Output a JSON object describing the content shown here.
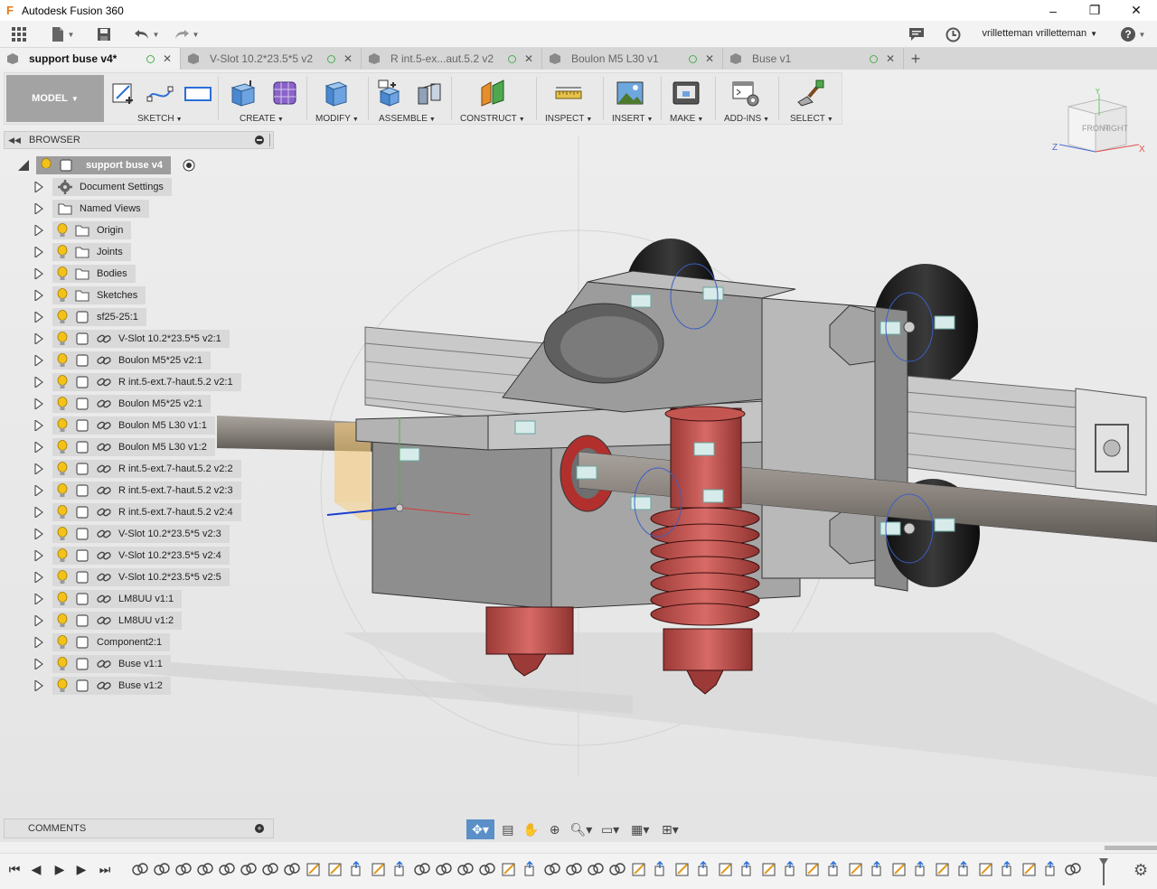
{
  "window": {
    "title": "Autodesk Fusion 360",
    "app_icon": "F",
    "minimize": "–",
    "restore": "❐",
    "close": "✕"
  },
  "quickbar": {
    "user": "vrilletteman vrilletteman"
  },
  "tabs": [
    {
      "label": "support buse v4*",
      "active": true
    },
    {
      "label": "V-Slot 10.2*23.5*5 v2",
      "active": false
    },
    {
      "label": "R int.5-ex...aut.5.2 v2",
      "active": false
    },
    {
      "label": "Boulon M5 L30 v1",
      "active": false
    },
    {
      "label": "Buse v1",
      "active": false
    }
  ],
  "toolbar": {
    "workspace": "MODEL",
    "groups": [
      "SKETCH",
      "CREATE",
      "MODIFY",
      "ASSEMBLE",
      "CONSTRUCT",
      "INSPECT",
      "INSERT",
      "MAKE",
      "ADD-INS",
      "SELECT"
    ]
  },
  "viewcube": {
    "front": "FRONT",
    "right": "RIGHT",
    "axis_x": "X",
    "axis_y": "Y",
    "axis_z": "Z"
  },
  "browser": {
    "title": "BROWSER",
    "root": "support buse v4",
    "items": [
      {
        "label": "Document Settings",
        "icon": "gear-icon",
        "bulb": false,
        "link": false
      },
      {
        "label": "Named Views",
        "icon": "folder-icon",
        "bulb": false,
        "link": false
      },
      {
        "label": "Origin",
        "icon": "folder-icon",
        "bulb": true,
        "link": false
      },
      {
        "label": "Joints",
        "icon": "folder-icon",
        "bulb": true,
        "link": false
      },
      {
        "label": "Bodies",
        "icon": "folder-icon",
        "bulb": true,
        "link": false
      },
      {
        "label": "Sketches",
        "icon": "folder-icon",
        "bulb": true,
        "link": false
      },
      {
        "label": "sf25-25:1",
        "icon": "component-icon",
        "bulb": true,
        "link": false
      },
      {
        "label": "V-Slot 10.2*23.5*5 v2:1",
        "icon": "component-icon",
        "bulb": true,
        "link": true
      },
      {
        "label": "Boulon M5*25 v2:1",
        "icon": "component-icon",
        "bulb": true,
        "link": true
      },
      {
        "label": "R int.5-ext.7-haut.5.2 v2:1",
        "icon": "component-icon",
        "bulb": true,
        "link": true
      },
      {
        "label": "Boulon M5*25 v2:1",
        "icon": "component-icon",
        "bulb": true,
        "link": true
      },
      {
        "label": "Boulon M5 L30 v1:1",
        "icon": "component-icon",
        "bulb": true,
        "link": true
      },
      {
        "label": "Boulon M5 L30 v1:2",
        "icon": "component-icon",
        "bulb": true,
        "link": true
      },
      {
        "label": "R int.5-ext.7-haut.5.2 v2:2",
        "icon": "component-icon",
        "bulb": true,
        "link": true
      },
      {
        "label": "R int.5-ext.7-haut.5.2 v2:3",
        "icon": "component-icon",
        "bulb": true,
        "link": true
      },
      {
        "label": "R int.5-ext.7-haut.5.2 v2:4",
        "icon": "component-icon",
        "bulb": true,
        "link": true
      },
      {
        "label": "V-Slot 10.2*23.5*5 v2:3",
        "icon": "component-icon",
        "bulb": true,
        "link": true
      },
      {
        "label": "V-Slot 10.2*23.5*5 v2:4",
        "icon": "component-icon",
        "bulb": true,
        "link": true
      },
      {
        "label": "V-Slot 10.2*23.5*5 v2:5",
        "icon": "component-icon",
        "bulb": true,
        "link": true
      },
      {
        "label": "LM8UU v1:1",
        "icon": "component-icon",
        "bulb": true,
        "link": true
      },
      {
        "label": "LM8UU v1:2",
        "icon": "component-icon",
        "bulb": true,
        "link": true
      },
      {
        "label": "Component2:1",
        "icon": "component-icon",
        "bulb": true,
        "link": false
      },
      {
        "label": "Buse v1:1",
        "icon": "component-icon",
        "bulb": true,
        "link": true
      },
      {
        "label": "Buse v1:2",
        "icon": "component-icon",
        "bulb": true,
        "link": true
      }
    ]
  },
  "comments": {
    "title": "COMMENTS"
  },
  "colors": {
    "accent": "#5a8fc7",
    "model_gray": "#9a9a9a",
    "nozzle_red": "#c0504d",
    "bulb_yellow": "#f2c21b"
  }
}
